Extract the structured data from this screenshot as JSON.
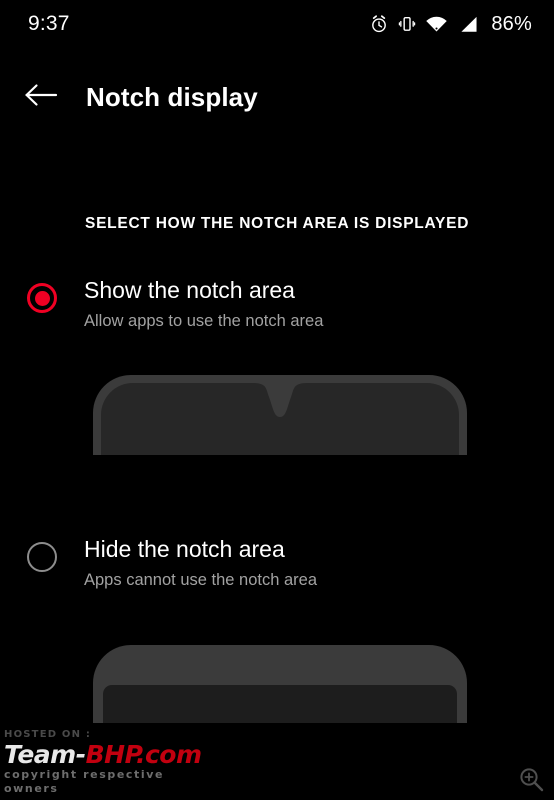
{
  "status_bar": {
    "time": "9:37",
    "battery_percent": "86%",
    "icons": [
      "alarm-icon",
      "vibrate-icon",
      "wifi-icon",
      "cellular-signal-icon"
    ]
  },
  "app_bar": {
    "back_icon": "back-arrow-icon",
    "title": "Notch display"
  },
  "section": {
    "header": "SELECT HOW THE NOTCH AREA IS DISPLAYED"
  },
  "options": [
    {
      "id": "show",
      "title": "Show the notch area",
      "subtitle": "Allow apps to use the notch area",
      "selected": true,
      "preview": "phone-with-waterdrop-notch"
    },
    {
      "id": "hide",
      "title": "Hide the notch area",
      "subtitle": "Apps cannot use the notch area",
      "selected": false,
      "preview": "phone-with-hidden-notch"
    }
  ],
  "watermark": {
    "hosted_on": "HOSTED ON :",
    "brand_first": "Team-",
    "brand_second": "BHP.com",
    "copyright": "copyright respective owners"
  },
  "zoom_badge": {
    "icon": "zoom-in-icon"
  },
  "colors": {
    "background": "#000000",
    "accent_red": "#f00023",
    "primary_text": "#ffffff",
    "secondary_text": "#a2a2a2",
    "radio_unselected": "#8d8d8d",
    "phone_body": "#3b3b3b",
    "phone_screen": "#272727",
    "watermark_red": "#c2000f"
  }
}
